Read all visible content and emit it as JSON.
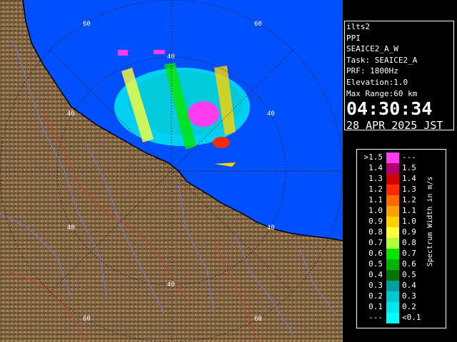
{
  "info": {
    "station": "ilts2",
    "mode": "PPI",
    "scan": "SEAICE2_A_W",
    "task": "Task: SEAICE2_A",
    "prf": "PRF: 1800Hz",
    "elevation": "Elevation:1.0",
    "max_range": "Max Range:60 km",
    "time": "04:30:34",
    "date": "28 APR 2025 JST"
  },
  "range_labels": {
    "r60": "60",
    "r40": "40"
  },
  "legend": {
    "unit": "Spectrum Width in m/s",
    "rows": [
      {
        "left": ">1.5",
        "right": "---",
        "color": "#ff3cf0"
      },
      {
        "left": "1.4",
        "right": "1.5",
        "color": "#b4006e"
      },
      {
        "left": "1.3",
        "right": "1.4",
        "color": "#d20000"
      },
      {
        "left": "1.2",
        "right": "1.3",
        "color": "#ff2a00"
      },
      {
        "left": "1.1",
        "right": "1.2",
        "color": "#ff6a00"
      },
      {
        "left": "1.0",
        "right": "1.1",
        "color": "#ffa000"
      },
      {
        "left": "0.9",
        "right": "1.0",
        "color": "#ffd200"
      },
      {
        "left": "0.8",
        "right": "0.9",
        "color": "#ffff3c"
      },
      {
        "left": "0.7",
        "right": "0.8",
        "color": "#b4ff3c"
      },
      {
        "left": "0.6",
        "right": "0.7",
        "color": "#00e600"
      },
      {
        "left": "0.5",
        "right": "0.6",
        "color": "#00b400"
      },
      {
        "left": "0.4",
        "right": "0.5",
        "color": "#007800"
      },
      {
        "left": "0.3",
        "right": "0.4",
        "color": "#00a0a0"
      },
      {
        "left": "0.2",
        "right": "0.3",
        "color": "#00c8d2"
      },
      {
        "left": "0.1",
        "right": "0.2",
        "color": "#00e6f0"
      },
      {
        "left": "---",
        "right": "<0.1",
        "color": "#00ffff"
      }
    ]
  },
  "colors": {
    "sea": "#0050ff",
    "land": "#8a6a45",
    "rivers": "#6e7ad2",
    "borders": "#c83c3c"
  }
}
